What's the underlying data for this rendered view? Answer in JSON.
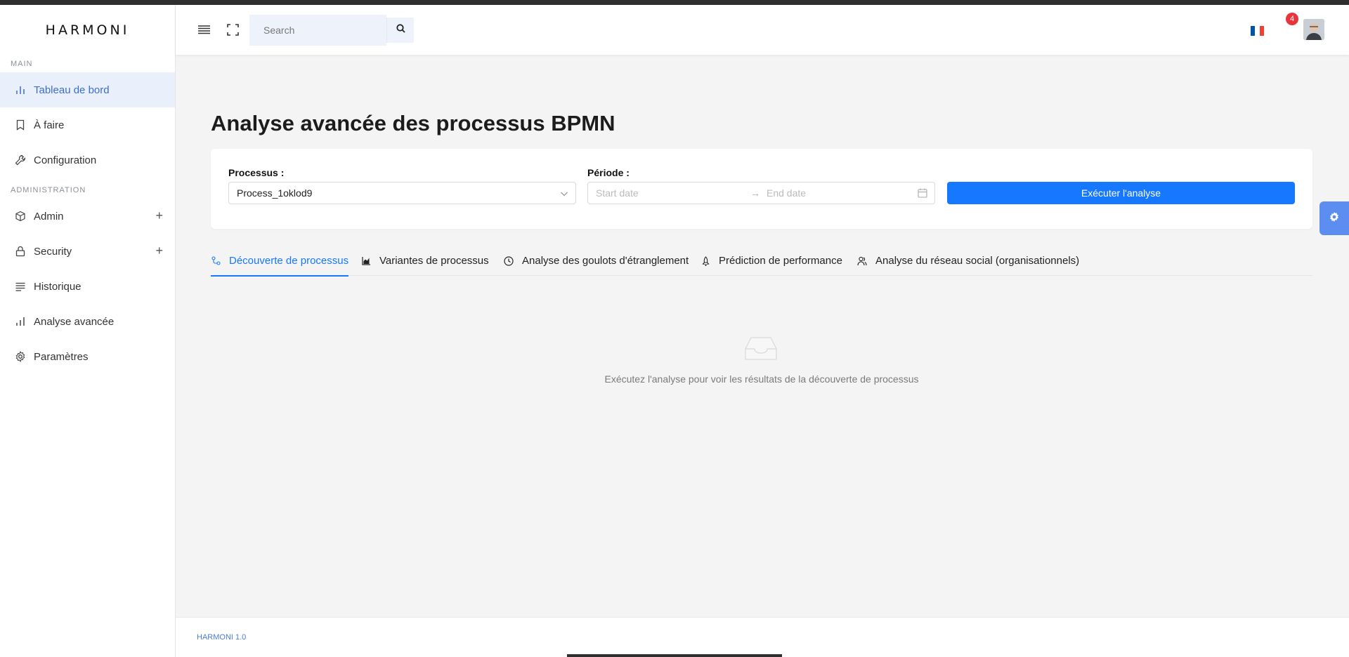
{
  "brand": "HARMONI",
  "sidebar": {
    "sections": [
      {
        "label": "MAIN"
      },
      {
        "label": "ADMINISTRATION"
      }
    ],
    "items": [
      {
        "label": "Tableau de bord",
        "icon": "bar-chart-icon"
      },
      {
        "label": "À faire",
        "icon": "bookmark-icon"
      },
      {
        "label": "Configuration",
        "icon": "wrench-icon"
      },
      {
        "label": "Admin",
        "icon": "cube-icon",
        "expand": "+"
      },
      {
        "label": "Security",
        "icon": "lock-icon",
        "expand": "+"
      },
      {
        "label": "Historique",
        "icon": "list-icon"
      },
      {
        "label": "Analyse avancée",
        "icon": "bar-chart-icon"
      },
      {
        "label": "Paramètres",
        "icon": "gear-icon"
      }
    ]
  },
  "header": {
    "search_placeholder": "Search",
    "notifications_count": "4",
    "flag_colors": [
      "#0055a4",
      "#ffffff",
      "#ef4135"
    ]
  },
  "main": {
    "title": "Analyse avancée des processus BPMN",
    "process_label": "Processus :",
    "process_value": "Process_1oklod9",
    "period_label": "Période :",
    "start_placeholder": "Start date",
    "end_placeholder": "End date",
    "range_arrow": "→",
    "run_button": "Exécuter l'analyse",
    "tabs": [
      {
        "label": "Découverte de processus",
        "icon": "discovery-icon"
      },
      {
        "label": "Variantes de processus",
        "icon": "area-chart-icon"
      },
      {
        "label": "Analyse des goulots d'étranglement",
        "icon": "clock-icon"
      },
      {
        "label": "Prédiction de performance",
        "icon": "rocket-icon"
      },
      {
        "label": "Analyse du réseau social (organisationnels)",
        "icon": "team-icon"
      }
    ],
    "empty_text": "Exécutez l'analyse pour voir les résultats de la découverte de processus"
  },
  "footer": {
    "text": "HARMONI 1.0"
  },
  "colors": {
    "primary": "#1677ff",
    "active_nav_bg": "#eaf0fb",
    "active_nav_text": "#3b6dd6",
    "badge": "#e8343a"
  }
}
